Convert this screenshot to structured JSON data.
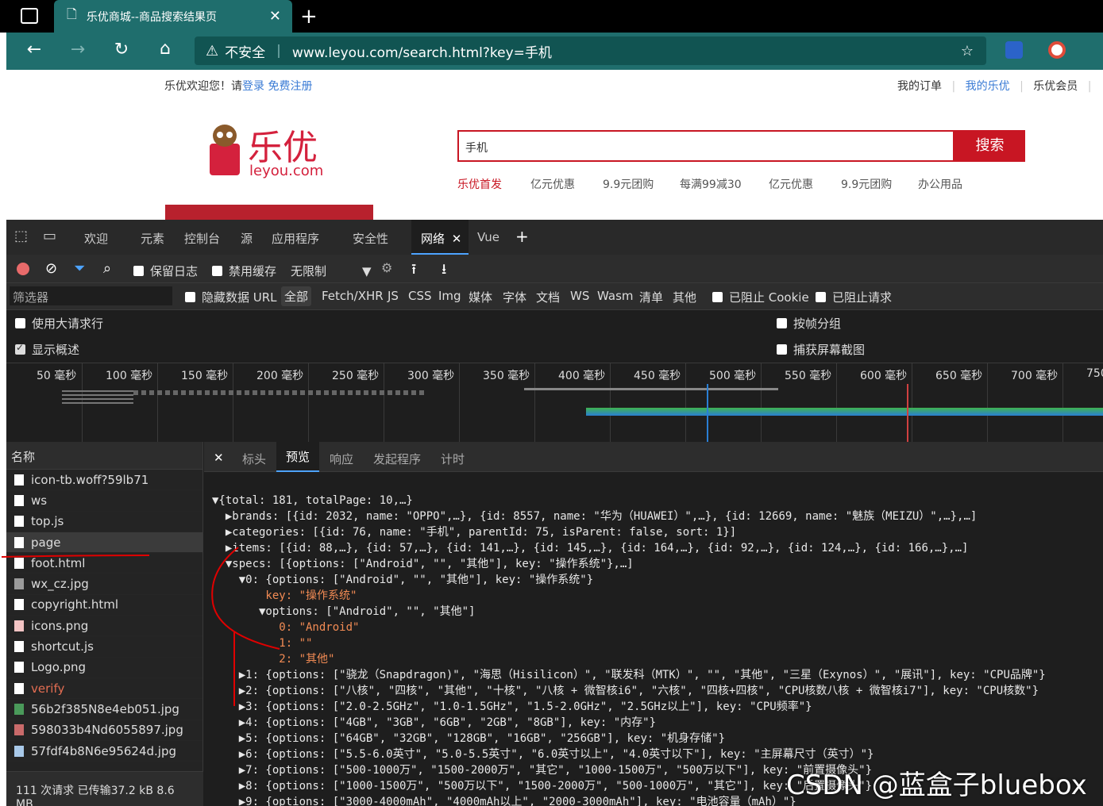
{
  "browser": {
    "tab_title": "乐优商城--商品搜索结果页",
    "address_warning": "不安全",
    "url": "www.leyou.com/search.html?key=手机"
  },
  "site": {
    "welcome": "乐优欢迎您！请",
    "login": "登录",
    "register": "免费注册",
    "top_links": [
      "我的订单",
      "我的乐优",
      "乐优会员"
    ],
    "logo_text": "乐优",
    "logo_domain": "leyou.com",
    "search_value": "手机",
    "search_button": "搜索",
    "hot_links": [
      "乐优首发",
      "亿元优惠",
      "9.9元团购",
      "每满99减30",
      "亿元优惠",
      "9.9元团购",
      "办公用品"
    ]
  },
  "devtools": {
    "tabs": [
      "欢迎",
      "元素",
      "控制台",
      "源",
      "应用程序",
      "安全性",
      "网络",
      "Vue"
    ],
    "toolbar": {
      "preserve_log": "保留日志",
      "disable_cache": "禁用缓存",
      "throttle": "无限制"
    },
    "filter_placeholder": "筛选器",
    "filter": {
      "hide_data_url": "隐藏数据 URL",
      "types": [
        "全部",
        "Fetch/XHR",
        "JS",
        "CSS",
        "Img",
        "媒体",
        "字体",
        "文档",
        "WS",
        "Wasm",
        "清单",
        "其他"
      ],
      "blocked_cookies": "已阻止 Cookie",
      "blocked_requests": "已阻止请求"
    },
    "options": {
      "large_rows": "使用大请求行",
      "overview": "显示概述",
      "group_by_frame": "按帧分组",
      "screenshots": "捕获屏幕截图"
    },
    "timeline_ticks": [
      "50 毫秒",
      "100 毫秒",
      "150 毫秒",
      "200 毫秒",
      "250 毫秒",
      "300 毫秒",
      "350 毫秒",
      "400 毫秒",
      "450 毫秒",
      "500 毫秒",
      "550 毫秒",
      "600 毫秒",
      "650 毫秒",
      "700 毫秒",
      "750"
    ],
    "name_header": "名称",
    "files": [
      "icon-tb.woff?59lb71",
      "ws",
      "top.js",
      "page",
      "foot.html",
      "wx_cz.jpg",
      "copyright.html",
      "icons.png",
      "shortcut.js",
      "Logo.png",
      "verify",
      "56b2f385N8e4eb051.jpg",
      "598033b4Nd6055897.jpg",
      "57fdf4b8N6e95624d.jpg"
    ],
    "status": "111 次请求  已传输37.2 kB  8.6 MB",
    "detail_tabs": [
      "标头",
      "预览",
      "响应",
      "发起程序",
      "计时"
    ],
    "preview_lines": [
      "▼{total: 181, totalPage: 10,…}",
      "  ▶brands: [{id: 2032, name: \"OPPO\",…}, {id: 8557, name: \"华为（HUAWEI）\",…}, {id: 12669, name: \"魅族（MEIZU）\",…},…]",
      "  ▶categories: [{id: 76, name: \"手机\", parentId: 75, isParent: false, sort: 1}]",
      "  ▶items: [{id: 88,…}, {id: 57,…}, {id: 141,…}, {id: 145,…}, {id: 164,…}, {id: 92,…}, {id: 124,…}, {id: 166,…},…]",
      "  ▼specs: [{options: [\"Android\", \"\", \"其他\"], key: \"操作系统\"},…]",
      "    ▼0: {options: [\"Android\", \"\", \"其他\"], key: \"操作系统\"}",
      "        key: \"操作系统\"",
      "       ▼options: [\"Android\", \"\", \"其他\"]",
      "          0: \"Android\"",
      "          1: \"\"",
      "          2: \"其他\"",
      "    ▶1: {options: [\"骁龙（Snapdragon)\", \"海思（Hisilicon）\", \"联发科（MTK）\", \"\", \"其他\", \"三星（Exynos）\", \"展讯\"], key: \"CPU品牌\"}",
      "    ▶2: {options: [\"八核\", \"四核\", \"其他\", \"十核\", \"八核 + 微智核i6\", \"六核\", \"四核+四核\", \"CPU核数八核 + 微智核i7\"], key: \"CPU核数\"}",
      "    ▶3: {options: [\"2.0-2.5GHz\", \"1.0-1.5GHz\", \"1.5-2.0GHz\", \"2.5GHz以上\"], key: \"CPU频率\"}",
      "    ▶4: {options: [\"4GB\", \"3GB\", \"6GB\", \"2GB\", \"8GB\"], key: \"内存\"}",
      "    ▶5: {options: [\"64GB\", \"32GB\", \"128GB\", \"16GB\", \"256GB\"], key: \"机身存储\"}",
      "    ▶6: {options: [\"5.5-6.0英寸\", \"5.0-5.5英寸\", \"6.0英寸以上\", \"4.0英寸以下\"], key: \"主屏幕尺寸（英寸）\"}",
      "    ▶7: {options: [\"500-1000万\", \"1500-2000万\", \"其它\", \"1000-1500万\", \"500万以下\"], key: \"前置摄像头\"}",
      "    ▶8: {options: [\"1000-1500万\", \"500万以下\", \"1500-2000万\", \"500-1000万\", \"其它\"], key: \"后置摄像头\"}",
      "    ▶9: {options: [\"3000-4000mAh\", \"4000mAh以上\", \"2000-3000mAh\"], key: \"电池容量（mAh）\"}"
    ]
  },
  "watermark": "CSDN @蓝盒子bluebox"
}
